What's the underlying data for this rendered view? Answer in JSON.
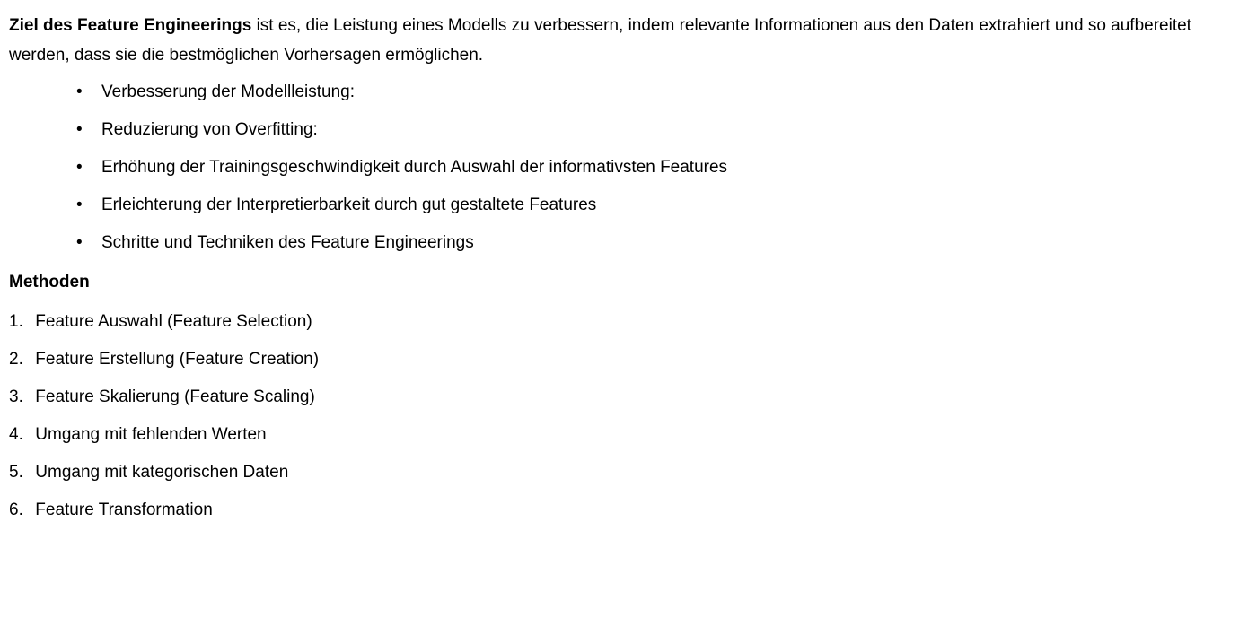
{
  "intro": {
    "bold_lead": "Ziel des Feature Engineerings",
    "rest": " ist es, die Leistung eines Modells zu verbessern, indem relevante Informationen aus den Daten extrahiert und so aufbereitet werden, dass sie die bestmöglichen Vorhersagen ermöglichen."
  },
  "goals": {
    "bullet_glyph": "•",
    "items": [
      "Verbesserung der Modellleistung:",
      "Reduzierung von Overfitting:",
      "Erhöhung der Trainingsgeschwindigkeit durch Auswahl der informativsten Features",
      "Erleichterung der Interpretierbarkeit durch gut gestaltete Features",
      "Schritte und Techniken des Feature Engineerings"
    ]
  },
  "methods": {
    "heading": "Methoden",
    "items": [
      {
        "num": "1.",
        "text": "Feature Auswahl (Feature Selection)"
      },
      {
        "num": "2.",
        "text": "Feature Erstellung (Feature Creation)"
      },
      {
        "num": "3.",
        "text": "Feature Skalierung (Feature Scaling)"
      },
      {
        "num": "4.",
        "text": "Umgang mit fehlenden Werten"
      },
      {
        "num": "5.",
        "text": "Umgang mit kategorischen Daten"
      },
      {
        "num": "6.",
        "text": "Feature Transformation"
      }
    ]
  }
}
